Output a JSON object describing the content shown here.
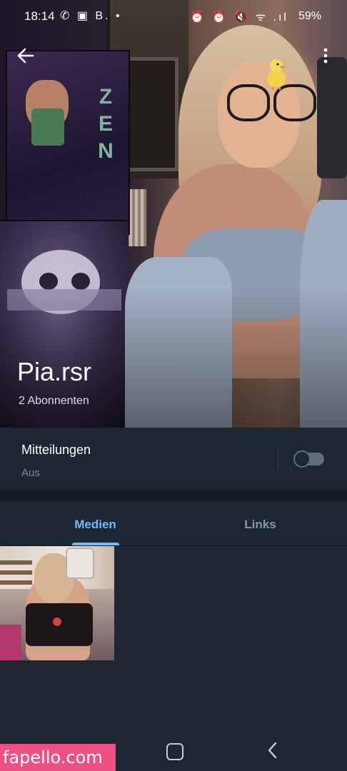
{
  "status_bar": {
    "time": "18:14",
    "left_icons": "✆ ▣ B. •",
    "right_icons": "⏰ ⏰ 🔇 ᯤ .ıl",
    "battery": "59%"
  },
  "header": {
    "back_icon": "arrow-left-icon",
    "more_icon": "more-vertical-icon",
    "profile_name": "Pia.rsr",
    "subscribers": "2 Abonnenten"
  },
  "notifications": {
    "title": "Mitteilungen",
    "status": "Aus",
    "enabled": false,
    "toggle_color": "#5f6e7d"
  },
  "tabs": [
    {
      "label": "Medien",
      "active": true
    },
    {
      "label": "Links",
      "active": false
    }
  ],
  "media": {
    "items": [
      {
        "type": "photo"
      }
    ]
  },
  "navbar": {
    "recent_icon": "recent-apps-icon",
    "home_icon": "home-icon",
    "back_icon": "back-icon"
  },
  "watermark": {
    "text": "fapello.com"
  },
  "colors": {
    "background": "#1d2733",
    "accent": "#71baf7",
    "muted_text": "#7d8b99",
    "watermark": "#ef4f85"
  }
}
